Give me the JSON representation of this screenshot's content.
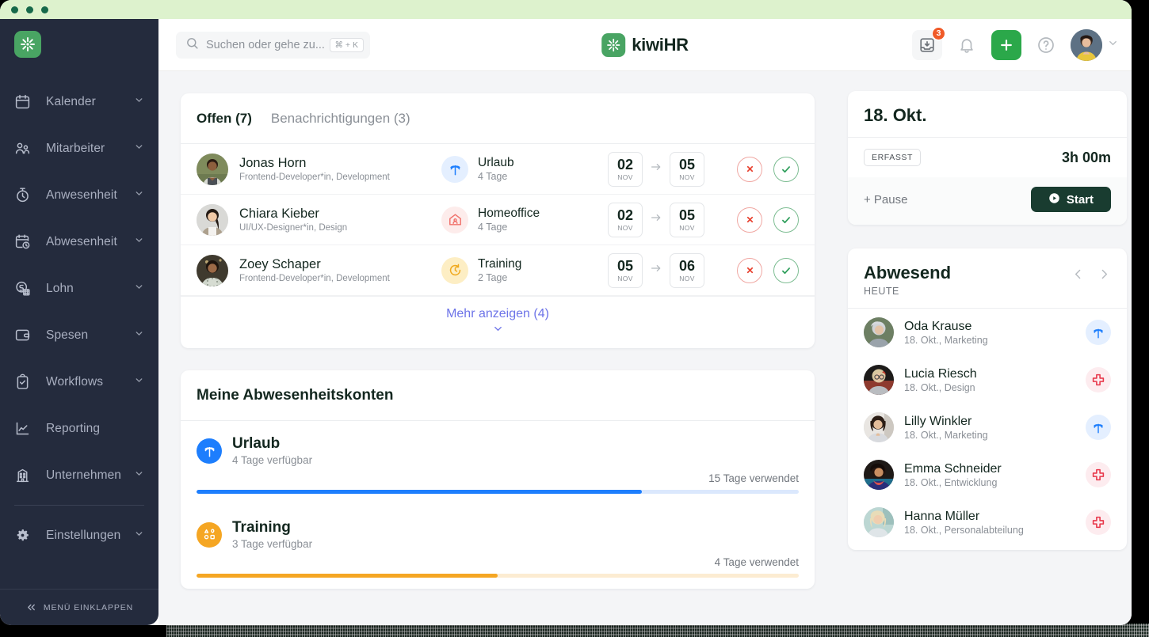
{
  "window": {
    "dots": 3
  },
  "sidebar": {
    "logo_alt": "kiwihr-logo",
    "items": [
      {
        "label": "Kalender",
        "icon": "calendar-icon",
        "expandable": true
      },
      {
        "label": "Mitarbeiter",
        "icon": "users-icon",
        "expandable": true
      },
      {
        "label": "Anwesenheit",
        "icon": "stopwatch-icon",
        "expandable": true
      },
      {
        "label": "Abwesenheit",
        "icon": "calendar-clock-icon",
        "expandable": true
      },
      {
        "label": "Lohn",
        "icon": "payroll-icon",
        "expandable": true
      },
      {
        "label": "Spesen",
        "icon": "wallet-icon",
        "expandable": true
      },
      {
        "label": "Workflows",
        "icon": "clipboard-check-icon",
        "expandable": true
      },
      {
        "label": "Reporting",
        "icon": "chart-line-icon",
        "expandable": false
      },
      {
        "label": "Unternehmen",
        "icon": "building-icon",
        "expandable": true
      },
      {
        "label": "Einstellungen",
        "icon": "gear-icon",
        "expandable": true
      }
    ],
    "collapse_label": "MENÜ EINKLAPPEN"
  },
  "topbar": {
    "search_placeholder": "Suchen oder gehe zu...",
    "search_shortcut": "⌘ + K",
    "brand": "kiwiHR",
    "inbox_badge": "3"
  },
  "requests": {
    "tabs": [
      {
        "label": "Offen (7)",
        "active": true
      },
      {
        "label": "Benachrichtigungen (3)",
        "active": false
      }
    ],
    "rows": [
      {
        "name": "Jonas Horn",
        "role": "Frontend-Developer*in, Development",
        "type": "Urlaub",
        "type_icon": "palm-tree-icon",
        "type_tone": "blue",
        "duration": "4 Tage",
        "from_day": "02",
        "from_month": "NOV",
        "to_day": "05",
        "to_month": "NOV"
      },
      {
        "name": "Chiara Kieber",
        "role": "UI/UX-Designer*in, Design",
        "type": "Homeoffice",
        "type_icon": "home-user-icon",
        "type_tone": "red",
        "duration": "4 Tage",
        "from_day": "02",
        "from_month": "NOV",
        "to_day": "05",
        "to_month": "NOV"
      },
      {
        "name": "Zoey Schaper",
        "role": "Frontend-Developer*in, Development",
        "type": "Training",
        "type_icon": "clock-arrow-icon",
        "type_tone": "yel",
        "duration": "2 Tage",
        "from_day": "05",
        "from_month": "NOV",
        "to_day": "06",
        "to_month": "NOV"
      }
    ],
    "more_label": "Mehr anzeigen (4)"
  },
  "accounts": {
    "title": "Meine Abwesenheitskonten",
    "items": [
      {
        "name": "Urlaub",
        "available": "4 Tage verfügbar",
        "used": "15 Tage verwendet",
        "percent": 74,
        "icon": "palm-tree-icon",
        "tone": "blue",
        "color": "#1d7efd"
      },
      {
        "name": "Training",
        "available": "3 Tage verfügbar",
        "used": "4 Tage verwendet",
        "percent": 50,
        "icon": "shapes-icon",
        "tone": "yel",
        "color": "#f5a623"
      }
    ]
  },
  "timetracking": {
    "date": "18. Okt.",
    "status": "ERFASST",
    "duration": "3h 00m",
    "pause_label": "+ Pause",
    "start_label": "Start"
  },
  "absent": {
    "title": "Abwesend",
    "subtitle": "HEUTE",
    "people": [
      {
        "name": "Oda Krause",
        "meta": "18. Okt., Marketing",
        "icon": "palm-tree-icon",
        "tone": "blue"
      },
      {
        "name": "Lucia Riesch",
        "meta": "18. Okt., Design",
        "icon": "medical-cross-icon",
        "tone": "red"
      },
      {
        "name": "Lilly Winkler",
        "meta": "18. Okt., Marketing",
        "icon": "palm-tree-icon",
        "tone": "blue"
      },
      {
        "name": "Emma Schneider",
        "meta": "18. Okt., Entwicklung",
        "icon": "medical-cross-icon",
        "tone": "red"
      },
      {
        "name": "Hanna Müller",
        "meta": "18. Okt., Personalabteilung",
        "icon": "medical-cross-icon",
        "tone": "red"
      }
    ]
  },
  "colors": {
    "brand_green": "#49a463",
    "accent_green": "#2ba84a",
    "dark_green": "#193c30",
    "sidebar": "#242b3d",
    "link": "#6d74e8",
    "badge_orange": "#f05a28",
    "blue": "#1d7efd",
    "orange": "#f5a623",
    "red": "#e8374a"
  }
}
